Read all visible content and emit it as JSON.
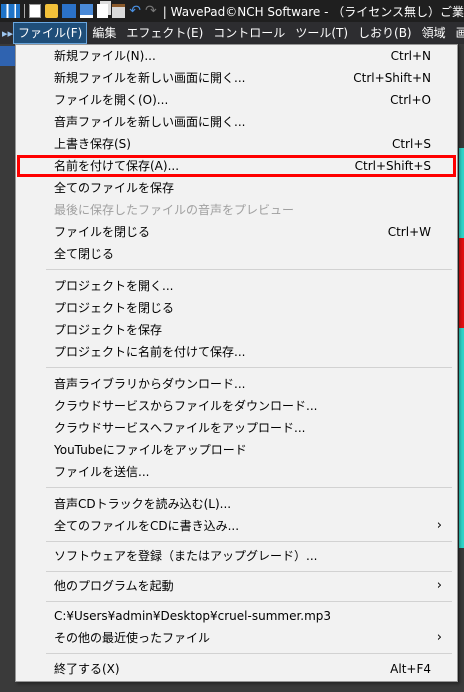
{
  "title_bar": {
    "title": "| WavePad©NCH Software - （ライセンス無し）ご業",
    "icons": [
      "wavepad-app-icon",
      "new-file-icon",
      "open-folder-icon",
      "save-icon",
      "save-as-icon",
      "copy-icon",
      "paste-icon",
      "undo-icon",
      "redo-icon"
    ]
  },
  "menubar": {
    "items": [
      "ファイル(F)",
      "編集",
      "エフェクト(E)",
      "コントロール",
      "ツール(T)",
      "しおり(B)",
      "領域",
      "画面表示"
    ],
    "active_index": 0
  },
  "file_menu": {
    "items": [
      {
        "label": "新規ファイル(N)...",
        "shortcut": "Ctrl+N"
      },
      {
        "label": "新規ファイルを新しい画面に開く...",
        "shortcut": "Ctrl+Shift+N"
      },
      {
        "label": "ファイルを開く(O)...",
        "shortcut": "Ctrl+O"
      },
      {
        "label": "音声ファイルを新しい画面に開く...",
        "shortcut": ""
      },
      {
        "label": "上書き保存(S)",
        "shortcut": "Ctrl+S"
      },
      {
        "label": "名前を付けて保存(A)...",
        "shortcut": "Ctrl+Shift+S"
      },
      {
        "label": "全てのファイルを保存",
        "shortcut": ""
      },
      {
        "label": "最後に保存したファイルの音声をプレビュー",
        "shortcut": ""
      },
      {
        "label": "ファイルを閉じる",
        "shortcut": "Ctrl+W"
      },
      {
        "label": "全て閉じる",
        "shortcut": ""
      },
      {
        "label": "プロジェクトを開く...",
        "shortcut": ""
      },
      {
        "label": "プロジェクトを閉じる",
        "shortcut": ""
      },
      {
        "label": "プロジェクトを保存",
        "shortcut": ""
      },
      {
        "label": "プロジェクトに名前を付けて保存...",
        "shortcut": ""
      },
      {
        "label": "音声ライブラリからダウンロード...",
        "shortcut": ""
      },
      {
        "label": "クラウドサービスからファイルをダウンロード...",
        "shortcut": ""
      },
      {
        "label": "クラウドサービスへファイルをアップロード...",
        "shortcut": ""
      },
      {
        "label": "YouTubeにファイルをアップロード",
        "shortcut": ""
      },
      {
        "label": "ファイルを送信...",
        "shortcut": ""
      },
      {
        "label": "音声CDトラックを読み込む(L)...",
        "shortcut": ""
      },
      {
        "label": "全てのファイルをCDに書き込み...",
        "shortcut": "",
        "submenu": true
      },
      {
        "label": "ソフトウェアを登録（またはアップグレード）...",
        "shortcut": ""
      },
      {
        "label": "他のプログラムを起動",
        "shortcut": "",
        "submenu": true
      },
      {
        "label": "C:¥Users¥admin¥Desktop¥cruel-summer.mp3",
        "shortcut": ""
      },
      {
        "label": "その他の最近使ったファイル",
        "shortcut": "",
        "submenu": true
      },
      {
        "label": "終了する(X)",
        "shortcut": "Alt+F4"
      }
    ],
    "highlighted": "名前を付けて保存(A)...",
    "disabled": [
      "最後に保存したファイルの音声をプレビュー"
    ],
    "submenu_arrow": "›"
  },
  "colors": {
    "highlight_box": "#ff0000",
    "menubar_active": "#1f4e79"
  }
}
